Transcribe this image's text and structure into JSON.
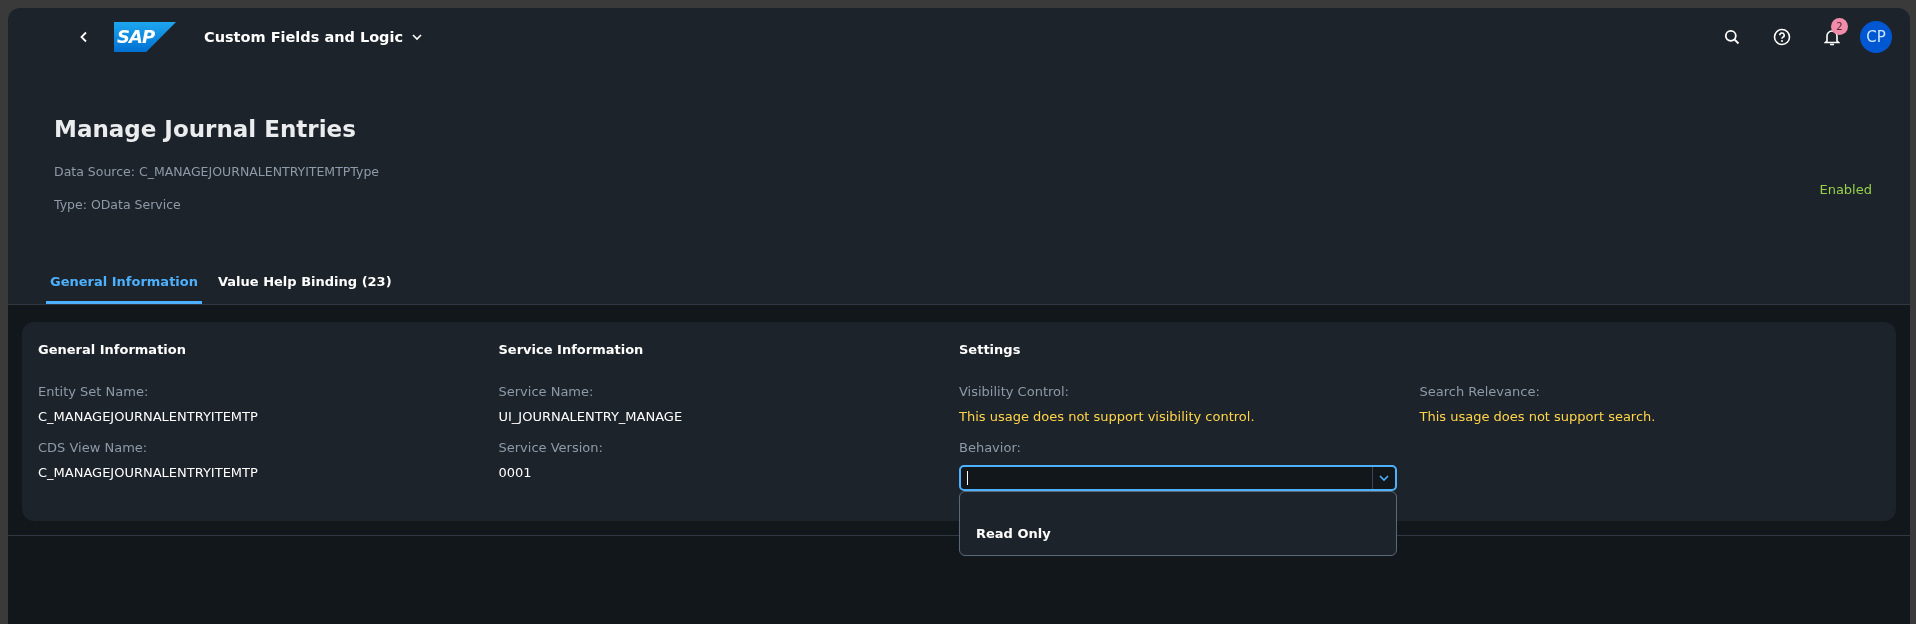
{
  "shell_bar": {
    "logo": "SAP",
    "app_title": "Custom Fields and Logic",
    "notification_count": "2",
    "avatar_initials": "CP"
  },
  "header": {
    "title": "Manage Journal Entries",
    "details": [
      "Data Source: C_MANAGEJOURNALENTRYITEMTPType",
      "Type: OData Service"
    ],
    "status": "Enabled"
  },
  "tabs": [
    {
      "label": "General Information",
      "selected": true
    },
    {
      "label": "Value Help Binding (23)",
      "selected": false
    }
  ],
  "sections": [
    {
      "title": "General Information",
      "fields": [
        {
          "kind": "text",
          "label": "Entity Set Name:",
          "value": "C_MANAGEJOURNALENTRYITEMTP"
        },
        {
          "kind": "text",
          "label": "CDS View Name:",
          "value": "C_MANAGEJOURNALENTRYITEMTP"
        }
      ]
    },
    {
      "title": "Service Information",
      "fields": [
        {
          "kind": "text",
          "label": "Service Name:",
          "value": "UI_JOURNALENTRY_MANAGE"
        },
        {
          "kind": "text",
          "label": "Service Version:",
          "value": "0001"
        }
      ]
    },
    {
      "title": "Settings",
      "fields": [
        {
          "kind": "warning",
          "label": "Visibility Control:",
          "value": "This usage does not support visibility control."
        },
        {
          "kind": "select",
          "label": "Behavior:",
          "expanded": true,
          "options": [
            {
              "label": "Read Only"
            }
          ]
        }
      ]
    },
    {
      "fields": [
        {
          "kind": "warning",
          "label": "Search Relevance:",
          "value": "This usage does not support search."
        }
      ]
    }
  ]
}
